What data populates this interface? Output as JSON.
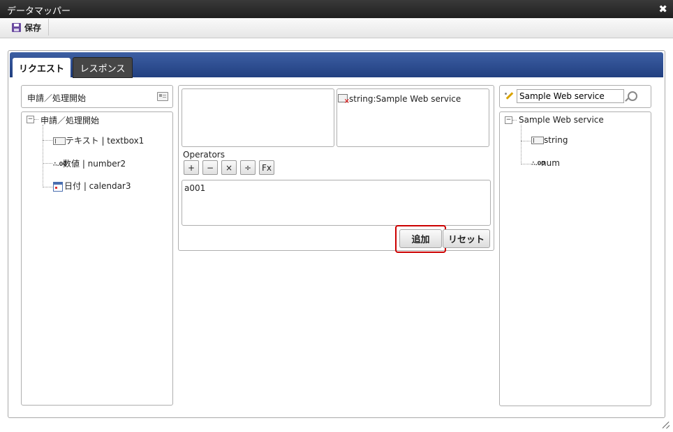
{
  "window": {
    "title": "データマッパー",
    "close": "✖"
  },
  "toolbar": {
    "save_label": "保存"
  },
  "tabs": [
    {
      "label": "リクエスト",
      "active": true
    },
    {
      "label": "レスポンス",
      "active": false
    }
  ],
  "left": {
    "header": "申請／処理開始",
    "root": "申請／処理開始",
    "expander": "−",
    "items": [
      {
        "label": "テキスト | textbox1",
        "icon": "text-icon"
      },
      {
        "label": "数値 | number2",
        "icon": "number-icon"
      },
      {
        "label": "日付 | calendar3",
        "icon": "calendar-icon"
      }
    ]
  },
  "center": {
    "target": "string:Sample Web service",
    "operators_label": "Operators",
    "operators": [
      "+",
      "−",
      "×",
      "÷",
      "Fx"
    ],
    "expression": "a001",
    "add_label": "追加",
    "reset_label": "リセット"
  },
  "right": {
    "search_value": "Sample Web service",
    "root": "Sample Web service",
    "expander": "−",
    "items": [
      {
        "label": "string",
        "icon": "text-icon"
      },
      {
        "label": "num",
        "icon": "number-icon"
      }
    ]
  },
  "icons": {
    "number_glyph": "∴.00"
  },
  "colors": {
    "tab_bar": "#2c4c90",
    "highlight": "#cc0000"
  }
}
